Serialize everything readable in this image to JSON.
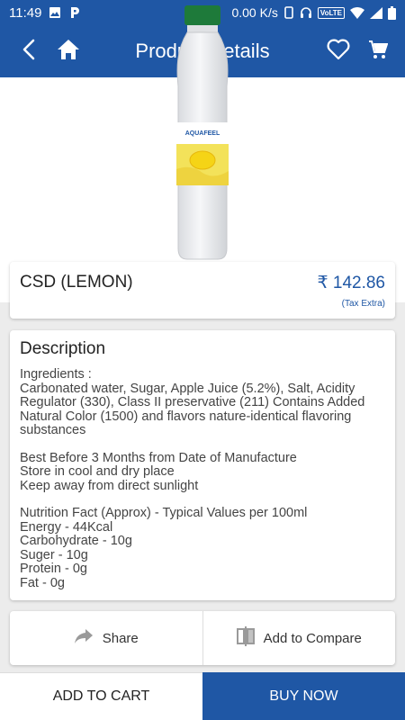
{
  "status_bar": {
    "time": "11:49",
    "speed": "0.00 K/s",
    "volte": "VoLTE"
  },
  "header": {
    "title": "Product Details",
    "back_icon": "back-arrow-icon",
    "home_icon": "home-icon",
    "wishlist_icon": "heart-icon",
    "cart_icon": "cart-icon"
  },
  "product": {
    "image_logo_text": "AQUAFEEL",
    "name": "CSD (LEMON)",
    "price": "₹ 142.86",
    "tax_note": "(Tax Extra)"
  },
  "description": {
    "title": "Description",
    "ingredients_heading": "Ingredients :",
    "ingredients": "Carbonated water, Sugar, Apple Juice (5.2%), Salt, Acidity Regulator (330), Class II preservative (211) Contains Added Natural Color (1500) and flavors nature-identical flavoring substances",
    "storage": [
      "Best Before 3 Months from Date of Manufacture",
      "Store in cool and dry place",
      "Keep away from direct sunlight"
    ],
    "nutrition": [
      "Nutrition Fact (Approx) - Typical Values per 100ml",
      "Energy - 44Kcal",
      "Carbohydrate - 10g",
      "Suger - 10g",
      "Protein - 0g",
      "Fat - 0g"
    ]
  },
  "actions": {
    "share": "Share",
    "compare": "Add to Compare"
  },
  "bottom": {
    "add_to_cart": "ADD TO CART",
    "buy_now": "BUY NOW"
  },
  "colors": {
    "primary": "#1f57a5",
    "bottle_cap": "#1e7a3a",
    "label_yellow": "#f3e25a"
  }
}
